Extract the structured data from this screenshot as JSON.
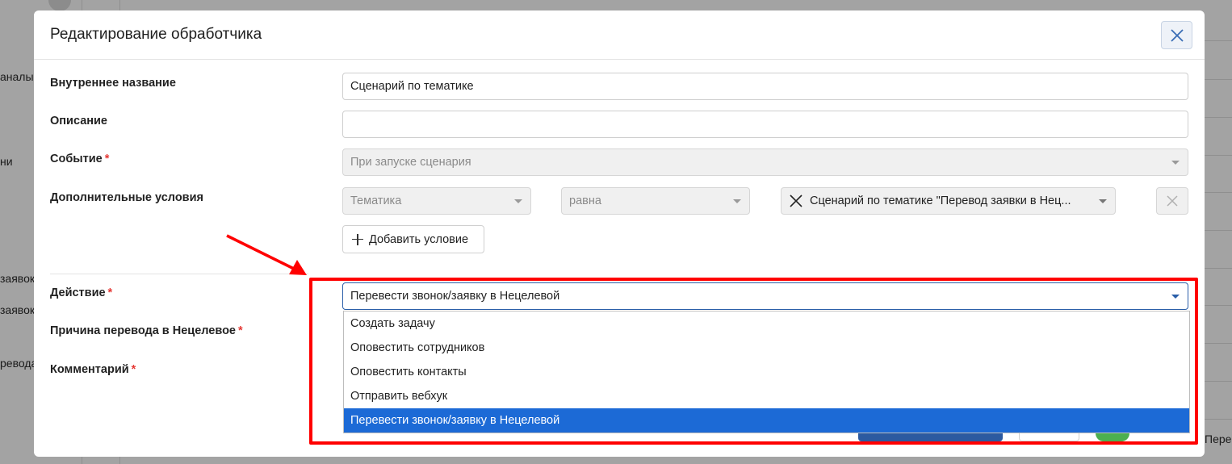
{
  "modal": {
    "title": "Редактирование обработчика"
  },
  "background": {
    "left_texts": [
      "аналы",
      "ни",
      "заявок",
      "заявок",
      "ревода"
    ],
    "right_text": "Пере"
  },
  "form": {
    "internal_name": {
      "label": "Внутреннее название",
      "value": "Сценарий по тематике"
    },
    "description": {
      "label": "Описание",
      "value": ""
    },
    "event": {
      "label": "Событие",
      "required_mark": "*",
      "value": "При запуске сценария"
    },
    "conditions": {
      "label": "Дополнительные условия",
      "field": "Тематика",
      "operator": "равна",
      "tag_value": "Сценарий по тематике \"Перевод заявки в Нец...",
      "add_button": "Добавить условие"
    },
    "action": {
      "label": "Действие",
      "required_mark": "*",
      "value": "Перевести звонок/заявку в Нецелевой",
      "options": [
        "Создать задачу",
        "Оповестить сотрудников",
        "Оповестить контакты",
        "Отправить вебхук",
        "Перевести звонок/заявку в Нецелевой"
      ],
      "selected_index": 4
    },
    "reason": {
      "label": "Причина перевода в Нецелевое",
      "required_mark": "*"
    },
    "comment": {
      "label": "Комментарий",
      "required_mark": "*"
    }
  },
  "colors": {
    "accent": "#1c6ad6",
    "highlight": "#ff0000",
    "required": "#e53935"
  }
}
